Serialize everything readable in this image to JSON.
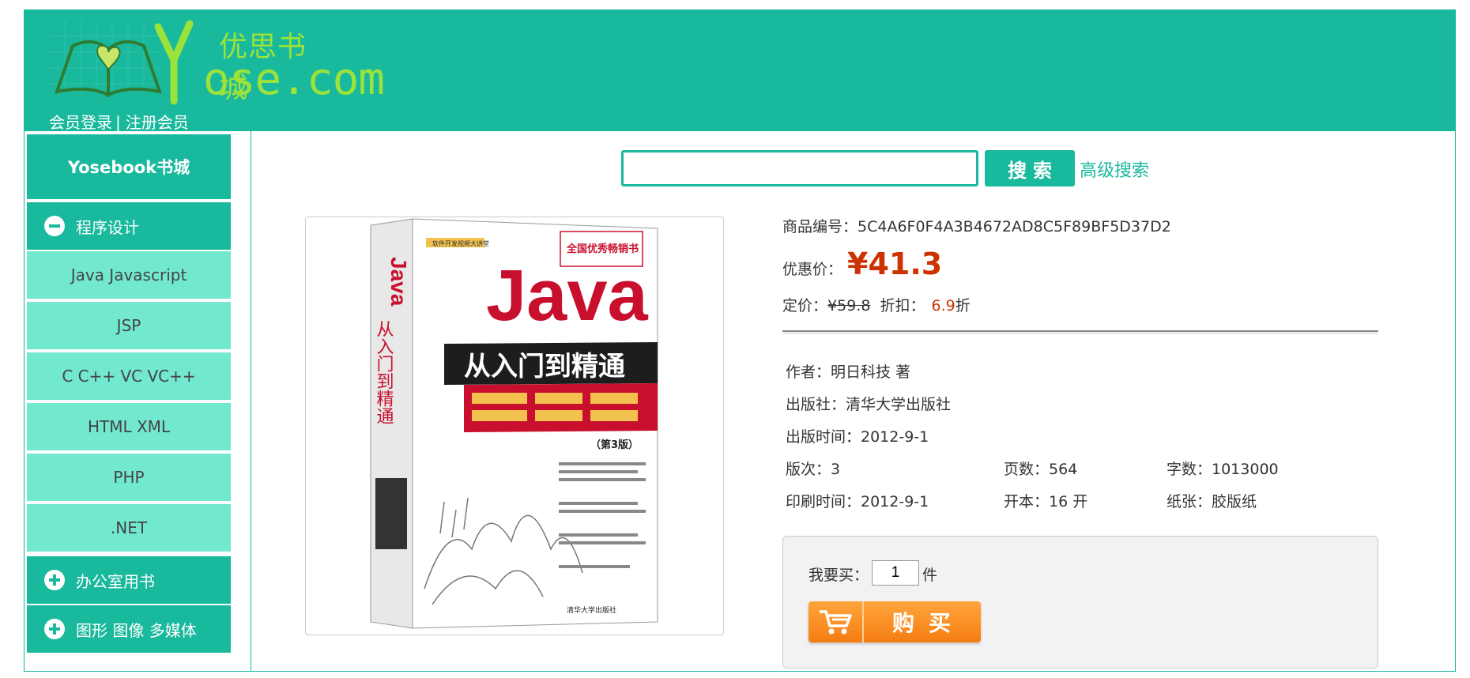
{
  "header": {
    "logo_cn": "优思书城",
    "logo_en": "ose.com",
    "logo_initial": "Y",
    "login_link": "会员登录",
    "separator": "|",
    "register_link": "注册会员"
  },
  "sidebar": {
    "title": "Yosebook书城",
    "categories": [
      {
        "label": "程序设计",
        "icon": "minus-circle-icon",
        "items": [
          "Java Javascript",
          "JSP",
          "C C++ VC VC++",
          "HTML XML",
          "PHP",
          ".NET"
        ]
      },
      {
        "label": "办公室用书",
        "icon": "plus-circle-icon"
      },
      {
        "label": "图形 图像 多媒体",
        "icon": "plus-circle-icon"
      }
    ]
  },
  "search": {
    "value": "",
    "button_label": "搜索",
    "advanced_label": "高级搜索"
  },
  "product": {
    "cover": {
      "series_tag": "软件开发视频大讲堂",
      "award": "全国优秀畅销书",
      "title_main": "Java",
      "title_sub": "从入门到精通",
      "edition": "（第3版）",
      "spine_text": "Java从入门到精通",
      "publisher_mark": "清华大学出版社"
    },
    "id_label": "商品编号：",
    "id_value": "5C4A6F0F4A3B4672AD8C5F89BF5D37D2",
    "sale_label": "优惠价：",
    "sale_price": "¥41.3",
    "list_label": "定价：",
    "list_price": "¥59.8",
    "discount_label": "折扣：",
    "discount_value": "6.9",
    "discount_unit": "折",
    "author": "作者：明日科技 著",
    "publisher": "出版社：清华大学出版社",
    "pub_date": "出版时间：2012-9-1",
    "edition_no": "版次：3",
    "pages": "页数：564",
    "word_count": "字数：1013000",
    "print_date": "印刷时间：2012-9-1",
    "format": "开本：16 开",
    "paper": "纸张：胶版纸"
  },
  "purchase": {
    "qty_label": "我要买：",
    "qty_value": "1",
    "qty_unit": "件",
    "buy_label": "购买"
  },
  "colors": {
    "brand": "#19b99d",
    "sub_item": "#72e8cf",
    "price": "#cc3300",
    "logo": "#9be33a",
    "buy_button": "#f57d12"
  }
}
